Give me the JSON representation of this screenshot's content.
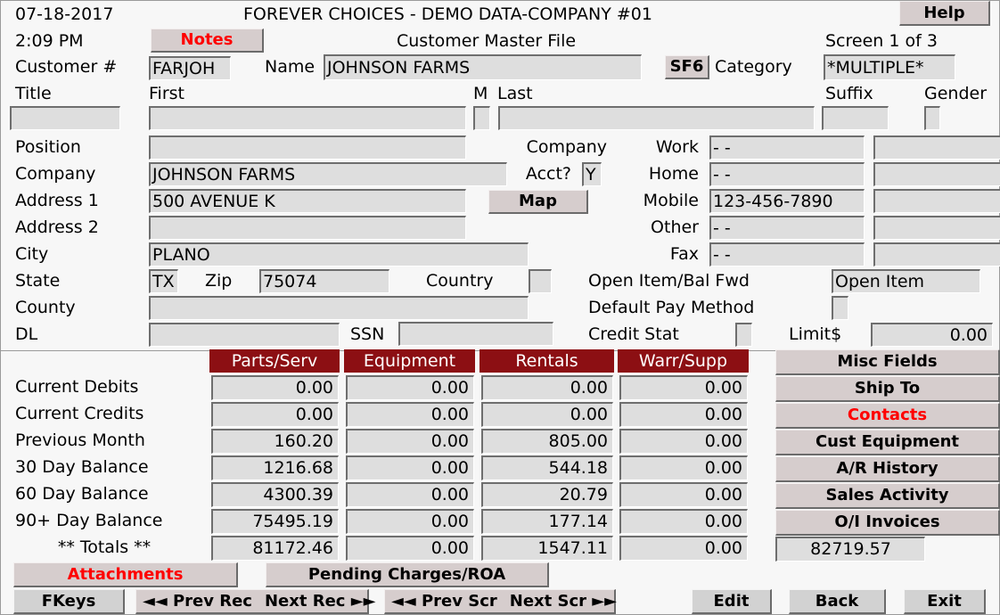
{
  "header": {
    "date": "07-18-2017",
    "time": "2:09 PM",
    "company_title": "FOREVER CHOICES - DEMO DATA-COMPANY #01",
    "screen_title": "Customer Master File",
    "screen_counter": "Screen 1 of 3",
    "help_label": "Help",
    "notes_label": "Notes"
  },
  "customer": {
    "customer_num_label": "Customer #",
    "customer_num_value": "FARJOH",
    "name_label": "Name",
    "name_value": "JOHNSON FARMS",
    "sf6_label": "SF6",
    "category_label": "Category",
    "category_value": "*MULTIPLE*"
  },
  "person": {
    "title_label": "Title",
    "title_value": "",
    "first_label": "First",
    "first_value": "",
    "middle_label": "M",
    "middle_value": "",
    "last_label": "Last",
    "last_value": "",
    "suffix_label": "Suffix",
    "suffix_value": "",
    "gender_label": "Gender",
    "gender_value": ""
  },
  "address": {
    "position_label": "Position",
    "position_value": "",
    "company_label": "Company",
    "company_value": "JOHNSON FARMS",
    "address1_label": "Address 1",
    "address1_value": "500 AVENUE K",
    "address2_label": "Address 2",
    "address2_value": "",
    "city_label": "City",
    "city_value": "PLANO",
    "state_label": "State",
    "state_value": "TX",
    "zip_label": "Zip",
    "zip_value": "75074",
    "country_label": "Country",
    "country_value": "",
    "county_label": "County",
    "county_value": "",
    "dl_label": "DL",
    "dl_value": "",
    "ssn_label": "SSN",
    "ssn_value": "",
    "map_label": "Map"
  },
  "company_acct": {
    "line1": "Company",
    "line2": "Acct?",
    "value": "Y"
  },
  "phones": [
    {
      "label": "Work",
      "value": "-    -",
      "ext": ""
    },
    {
      "label": "Home",
      "value": "-    -",
      "ext": ""
    },
    {
      "label": "Mobile",
      "value": "123-456-7890",
      "ext": ""
    },
    {
      "label": "Other",
      "value": "-    -",
      "ext": ""
    },
    {
      "label": "Fax",
      "value": "-    -",
      "ext": ""
    }
  ],
  "terms": {
    "open_item_label": "Open Item/Bal Fwd",
    "open_item_value": "Open Item",
    "pay_method_label": "Default Pay Method",
    "pay_method_value": "",
    "credit_stat_label": "Credit Stat",
    "credit_stat_value": "",
    "limit_label": "Limit$",
    "limit_value": "0.00"
  },
  "balances": {
    "columns": [
      "Parts/Serv",
      "Equipment",
      "Rentals",
      "Warr/Supp"
    ],
    "rows": [
      {
        "label": "Current Debits",
        "values": [
          "0.00",
          "0.00",
          "0.00",
          "0.00"
        ]
      },
      {
        "label": "Current Credits",
        "values": [
          "0.00",
          "0.00",
          "0.00",
          "0.00"
        ]
      },
      {
        "label": "Previous Month",
        "values": [
          "160.20",
          "0.00",
          "805.00",
          "0.00"
        ]
      },
      {
        "label": "30 Day Balance",
        "values": [
          "1216.68",
          "0.00",
          "544.18",
          "0.00"
        ]
      },
      {
        "label": "60 Day Balance",
        "values": [
          "4300.39",
          "0.00",
          "20.79",
          "0.00"
        ]
      },
      {
        "label": "90+ Day Balance",
        "values": [
          "75495.19",
          "0.00",
          "177.14",
          "0.00"
        ]
      },
      {
        "label": "** Totals **",
        "values": [
          "81172.46",
          "0.00",
          "1547.11",
          "0.00"
        ]
      }
    ],
    "grand_total": "82719.57"
  },
  "side_buttons": [
    {
      "label": "Misc Fields",
      "color": "black"
    },
    {
      "label": "Ship To",
      "color": "black"
    },
    {
      "label": "Contacts",
      "color": "red"
    },
    {
      "label": "Cust Equipment",
      "color": "black"
    },
    {
      "label": "A/R History",
      "color": "black"
    },
    {
      "label": "Sales Activity",
      "color": "black"
    },
    {
      "label": "O/I Invoices",
      "color": "black"
    }
  ],
  "bottom": {
    "attachments_label": "Attachments",
    "pending_label": "Pending Charges/ROA",
    "fkeys_label": "FKeys",
    "prev_rec_label": "◄◄ Prev Rec",
    "next_rec_label": "Next Rec ►►",
    "prev_scr_label": "◄◄ Prev Scr",
    "next_scr_label": "Next Scr ►►",
    "edit_label": "Edit",
    "back_label": "Back",
    "exit_label": "Exit"
  },
  "colors": {
    "header_red": "#8c0f13",
    "accent_red": "#ff0000",
    "field_bg": "#dedede",
    "button_bg": "#d6cdcd"
  }
}
